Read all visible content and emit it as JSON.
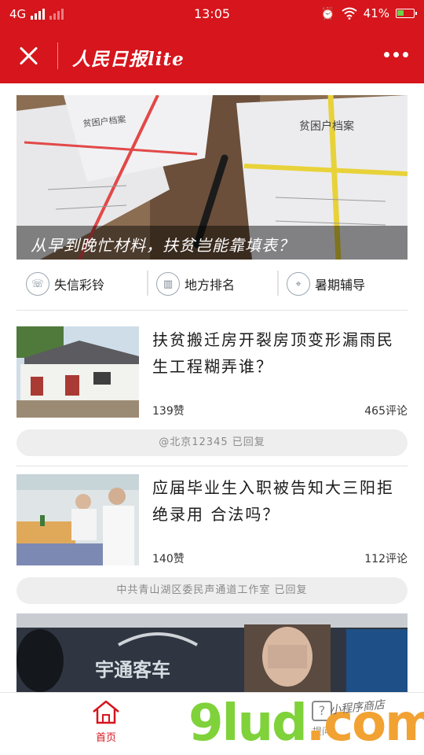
{
  "status_bar": {
    "network": "4G",
    "time": "13:05",
    "battery_percent": "41%",
    "battery_level": 0.41,
    "icons": [
      "signal-icon",
      "alarm-icon",
      "wifi-icon",
      "battery-icon"
    ]
  },
  "header": {
    "title": "人民日报lite",
    "close_icon": "close-icon",
    "more_icon": "more-dots-icon",
    "background": "#d6151c"
  },
  "hero": {
    "caption": "从早到晚忙材料，扶贫岂能靠填表？",
    "doc_label_left": "贫困户档案",
    "doc_label_right": "贫困户档案"
  },
  "quick_links": [
    {
      "label": "失信彩铃",
      "icon": "phone-icon"
    },
    {
      "label": "地方排名",
      "icon": "chart-icon"
    },
    {
      "label": "暑期辅导",
      "icon": "location-icon"
    }
  ],
  "articles": [
    {
      "title": "扶贫搬迁房开裂房顶变形漏雨民生工程糊弄谁？",
      "likes": "139赞",
      "comments": "465评论",
      "reply": "@北京12345 已回复"
    },
    {
      "title": "应届毕业生入职被告知大三阳拒绝录用 合法吗？",
      "likes": "140赞",
      "comments": "112评论",
      "reply": "中共青山湖区委民声通道工作室 已回复"
    }
  ],
  "bottom_image": {
    "sign_text": "宇通客车"
  },
  "tabbar": {
    "home_label": "首页",
    "ask_label": "提问",
    "accent": "#d6151c"
  },
  "watermark": {
    "brand": "9lud",
    "brand_suffix": ".com",
    "tag": "小程序商店"
  }
}
